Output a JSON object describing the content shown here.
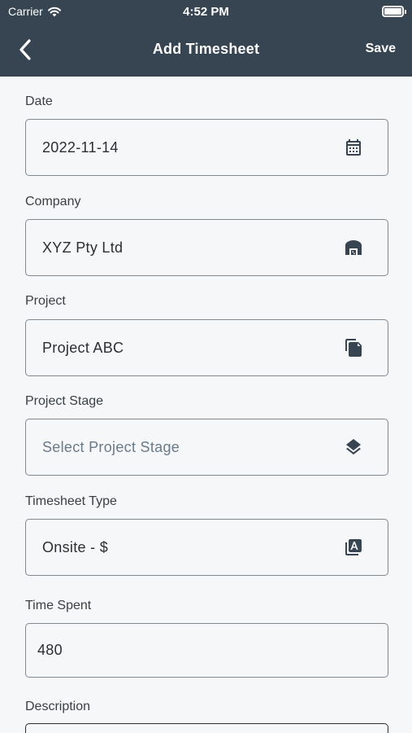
{
  "status_bar": {
    "carrier": "Carrier",
    "time": "4:52 PM"
  },
  "header": {
    "title": "Add Timesheet",
    "save_label": "Save"
  },
  "form": {
    "date": {
      "label": "Date",
      "value": "2022-11-14"
    },
    "company": {
      "label": "Company",
      "value": "XYZ Pty Ltd"
    },
    "project": {
      "label": "Project",
      "value": "Project ABC"
    },
    "project_stage": {
      "label": "Project Stage",
      "placeholder": "Select Project Stage"
    },
    "timesheet_type": {
      "label": "Timesheet Type",
      "value": "Onsite - $"
    },
    "time_spent": {
      "label": "Time Spent",
      "value": "480"
    },
    "description": {
      "label": "Description"
    }
  },
  "colors": {
    "header_bg": "#374452",
    "page_bg": "#f6f7f8",
    "icon": "#374452",
    "border": "#808890"
  },
  "icons": [
    "back-chevron-icon",
    "calendar-icon",
    "warehouse-icon",
    "file-copy-icon",
    "layers-icon",
    "font-box-icon",
    "wifi-icon",
    "battery-icon"
  ]
}
